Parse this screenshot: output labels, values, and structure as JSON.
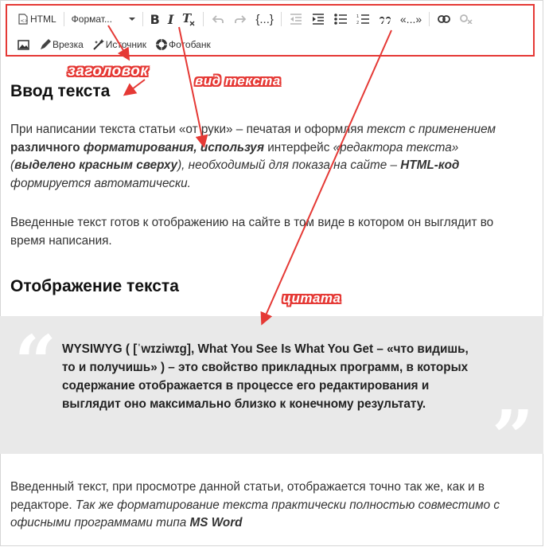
{
  "toolbar": {
    "html_label": "HTML",
    "format_label": "Формат...",
    "bold_label": "B",
    "italic_label": "I",
    "code_label": "{...}",
    "quote_label": "99",
    "snippet_label": "«...»",
    "insert_label": "Врезка",
    "source_label": "Источник",
    "photobank_label": "Фотобанк"
  },
  "annotations": {
    "heading": "заголовок",
    "text_style": "вид текста",
    "quote": "цитата",
    "color": "#e53935"
  },
  "content": {
    "title": "Ввод текста",
    "p1_a": "При написании текста статьи «от руки» – печатая и оформляя ",
    "p1_b": "текст с применением",
    "p1_c": " ",
    "p1_d": "различного",
    "p1_e": " ",
    "p1_f": "форматирования, используя",
    "p1_g": " интерфейс ",
    "p1_h": "«редактора текста» (",
    "p1_i": "выделено красным сверху",
    "p1_j": "), необходимый для показа на сайте – ",
    "p1_k": "HTML-код",
    "p1_l": " ",
    "p1_m": "формируется автоматически.",
    "p2": "Введенные текст готов к отображению на сайте в том виде в котором он выглядит во время написания.",
    "subtitle": "Отображение текста",
    "quote_text": "WYSIWYG ( [ˈwɪziwɪɡ], What You See Is What You Get – «что видишь, то и получишь» ) – это свойство прикладных программ, в которых содержание отображается в процессе его редактирования и выглядит оно максимально близко к конечному результату.",
    "p3_a": "Введенный текст, при просмотре данной статьи, отображается точно так же, как и в редакторе. ",
    "p3_b": "Так же форматирование текста практически полностью совместимо с офисными программами типа ",
    "p3_c": "MS Word"
  }
}
